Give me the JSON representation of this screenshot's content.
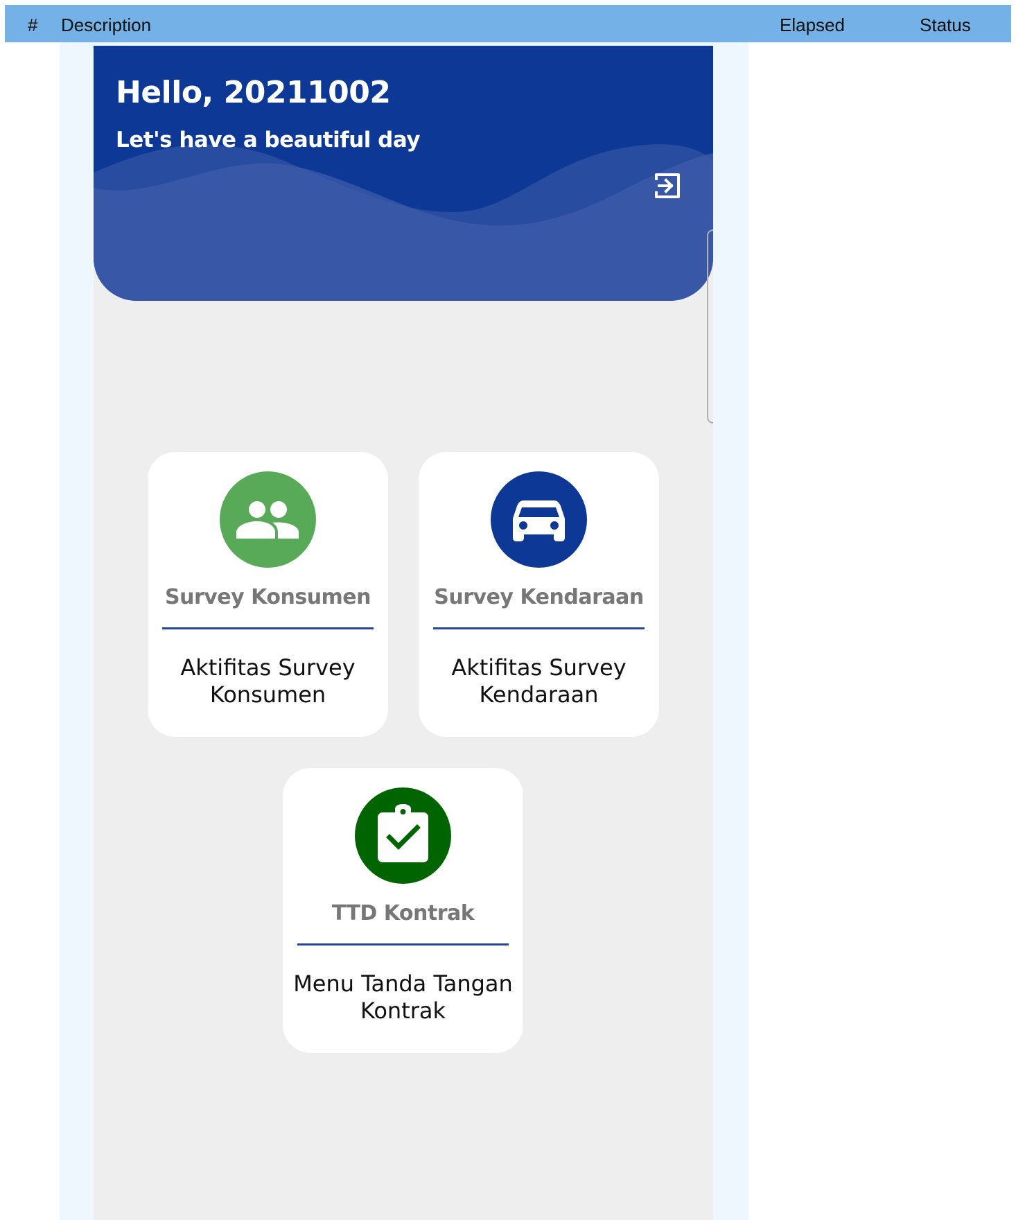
{
  "report_header": {
    "num": "#",
    "description": "Description",
    "elapsed": "Elapsed",
    "status": "Status"
  },
  "app": {
    "greeting": "Hello, 20211002",
    "subtitle": "Let's have a beautiful day",
    "colors": {
      "hero": "#0e3896",
      "hero_wave": "#3e5ca9",
      "divider": "#24479a",
      "background": "#eeeeee"
    }
  },
  "menu": [
    {
      "title": "Survey Konsumen",
      "description": "Aktifitas Survey Konsumen",
      "icon": "people-icon",
      "color": "#58aa58"
    },
    {
      "title": "Survey Kendaraan",
      "description": "Aktifitas Survey Kendaraan",
      "icon": "car-icon",
      "color": "#0e3896"
    },
    {
      "title": "TTD Kontrak",
      "description": "Menu Tanda Tangan Kontrak",
      "icon": "clipboard-check-icon",
      "color": "#006400"
    }
  ]
}
